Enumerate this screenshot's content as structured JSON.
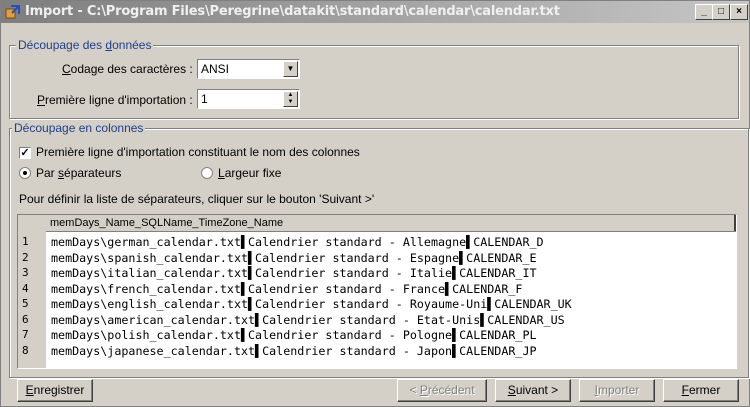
{
  "window": {
    "title": "Import - C:\\Program Files\\Peregrine\\datakit\\standard\\calendar\\calendar.txt",
    "min_glyph": "_",
    "max_glyph": "□",
    "close_glyph": "×"
  },
  "data_split": {
    "legend_pre": "Découpage des ",
    "legend_u": "d",
    "legend_post": "onnées",
    "encoding_label_u": "C",
    "encoding_label_post": "odage des caractères :",
    "encoding_value": "ANSI",
    "first_line_label_u": "P",
    "first_line_label_post": "remière ligne d'importation :",
    "first_line_value": "1"
  },
  "column_split": {
    "legend": "Découpage en colonnes",
    "header_checkbox_label": "Première ligne d'importation constituant le nom des colonnes",
    "header_checkbox_checked": true,
    "radio_separators_pre": "Par ",
    "radio_separators_u": "s",
    "radio_separators_post": "éparateurs",
    "radio_fixed_u": "L",
    "radio_fixed_post": "argeur fixe",
    "selected_mode": "separators",
    "hint": "Pour définir la liste de séparateurs, cliquer sur le bouton 'Suivant >'"
  },
  "preview": {
    "column_header": "memDays_Name_SQLName_TimeZone_Name",
    "line_numbers": [
      "1",
      "2",
      "3",
      "4",
      "5",
      "6",
      "7",
      "8"
    ],
    "lines": [
      "memDays\\german_calendar.txt▌Calendrier standard - Allemagne▌CALENDAR_D",
      "memDays\\spanish_calendar.txt▌Calendrier standard - Espagne▌CALENDAR_E",
      "memDays\\italian_calendar.txt▌Calendrier standard - Italie▌CALENDAR_IT",
      "memDays\\french_calendar.txt▌Calendrier standard - France▌CALENDAR_F",
      "memDays\\english_calendar.txt▌Calendrier standard - Royaume-Uni▌CALENDAR_UK",
      "memDays\\american_calendar.txt▌Calendrier standard - Etat-Unis▌CALENDAR_US",
      "memDays\\polish_calendar.txt▌Calendrier standard - Pologne▌CALENDAR_PL",
      "memDays\\japanese_calendar.txt▌Calendrier standard - Japon▌CALENDAR_JP"
    ]
  },
  "buttons": {
    "save_u": "E",
    "save_post": "nregistrer",
    "prev_pre": "< ",
    "prev_u": "P",
    "prev_post": "récédent",
    "next_u": "S",
    "next_post": "uivant >",
    "import_u": "I",
    "import_post": "mporter",
    "close_u": "F",
    "close_post": "ermer"
  },
  "icons": {
    "app": "import-app-icon",
    "dropdown": "chevron-down-icon",
    "spinner": "spin-arrows-icon",
    "check": "checkmark-icon"
  }
}
